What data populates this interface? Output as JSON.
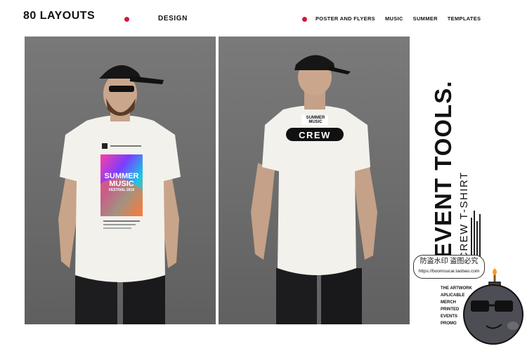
{
  "header": {
    "brand": "80 LAYOUTS",
    "design": "DESIGN",
    "tags": [
      "POSTER AND FLYERS",
      "MUSIC",
      "SUMMER",
      "TEMPLATES"
    ]
  },
  "front_shirt": {
    "print_title": "SUMMER MUSIC",
    "print_line1": "FESTIVAL",
    "print_line2": "2019"
  },
  "back_shirt": {
    "logo": "SUMMER MUSIC",
    "badge": "CREW"
  },
  "side": {
    "title": "EVENT TOOLS.",
    "subtitle": "CREW T-SHIRT",
    "art_lines": [
      "THE ARTWORK",
      "APLICABLE",
      "MERCH",
      "PRINTED",
      "EVENTS",
      "PROMO"
    ]
  },
  "watermark": {
    "line1": "防盗水印 盗图必究",
    "line2": "https://boomsucai.taobao.com"
  },
  "colors": {
    "accent": "#d4153c",
    "photo_bg": "#707070",
    "shirt": "#f3f1ec"
  }
}
